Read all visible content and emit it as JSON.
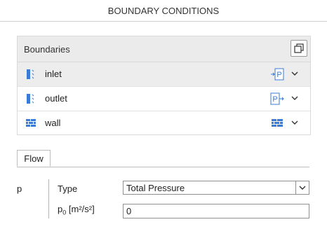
{
  "header": {
    "title": "BOUNDARY CONDITIONS"
  },
  "boundaries": {
    "title": "Boundaries",
    "items": [
      {
        "label": "inlet",
        "kind": "inlet",
        "badge": "P"
      },
      {
        "label": "outlet",
        "kind": "outlet",
        "badge": "P"
      },
      {
        "label": "wall",
        "kind": "wall",
        "badge": ""
      }
    ]
  },
  "tabs": [
    {
      "label": "Flow"
    }
  ],
  "flow": {
    "group_label": "p",
    "type_label": "Type",
    "type_value": "Total Pressure",
    "p0_symbol": "p",
    "p0_subscript": "0",
    "p0_units": "[m²/s²]",
    "p0_value": "0"
  },
  "colors": {
    "accent": "#3a7bd5",
    "selected_row": "#ededed",
    "header_bg": "#ebebeb"
  }
}
